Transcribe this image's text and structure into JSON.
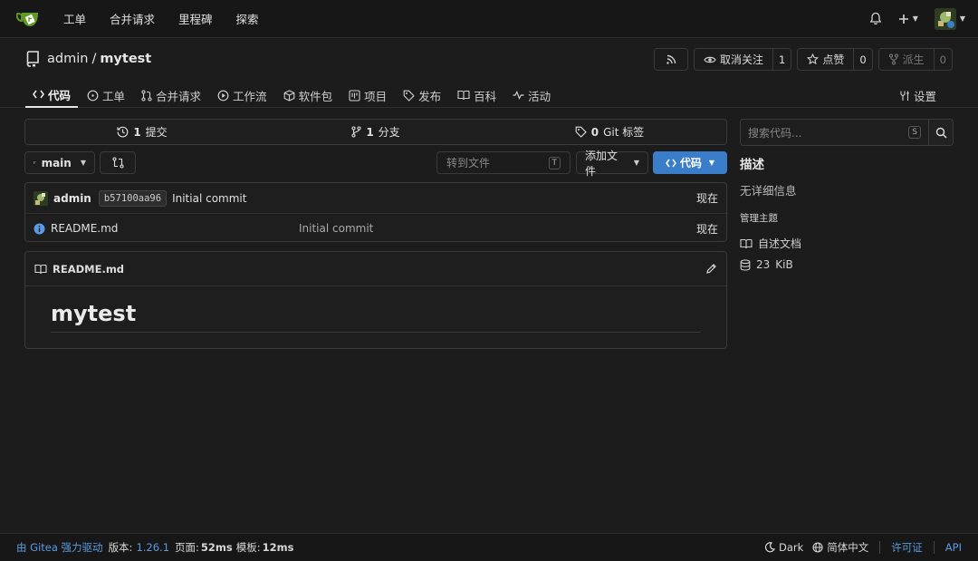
{
  "nav": {
    "items": [
      "工单",
      "合并请求",
      "里程碑",
      "探索"
    ]
  },
  "repo": {
    "owner": "admin",
    "separator": "/",
    "name": "mytest",
    "watch_label": "取消关注",
    "watch_count": "1",
    "star_label": "点赞",
    "star_count": "0",
    "fork_label": "派生",
    "fork_count": "0"
  },
  "tabs": {
    "code": "代码",
    "issues": "工单",
    "pulls": "合并请求",
    "actions": "工作流",
    "packages": "软件包",
    "projects": "项目",
    "releases": "发布",
    "wiki": "百科",
    "activity": "活动",
    "settings": "设置"
  },
  "stats": {
    "commits_num": "1",
    "commits_label": "提交",
    "branches_num": "1",
    "branches_label": "分支",
    "tags_num": "0",
    "tags_label": "Git 标签"
  },
  "branch": {
    "current": "main",
    "goto_placeholder": "转到文件",
    "goto_key": "T",
    "add_file": "添加文件",
    "code_button": "代码"
  },
  "last_commit": {
    "author": "admin",
    "sha": "b57100aa96",
    "message": "Initial commit",
    "time": "现在"
  },
  "files": [
    {
      "name": "README.md",
      "message": "Initial commit",
      "time": "现在"
    }
  ],
  "readme": {
    "filename": "README.md",
    "heading": "mytest"
  },
  "sidebar": {
    "search_placeholder": "搜索代码...",
    "search_key": "S",
    "about_title": "描述",
    "description": "无详细信息",
    "manage_topics": "管理主题",
    "readme_link": "自述文档",
    "size_value": "23",
    "size_unit": "KiB"
  },
  "footer": {
    "powered": "由 Gitea 强力驱动",
    "version_label": "版本:",
    "version": "1.26.1",
    "page_label": "页面:",
    "page_time": "52ms",
    "template_label": "模板:",
    "template_time": "12ms",
    "theme": "Dark",
    "language": "简体中文",
    "license": "许可证",
    "api": "API"
  },
  "colors": {
    "accent": "#3a7ec9",
    "link": "#5a9be0",
    "logo_green": "#609926"
  }
}
